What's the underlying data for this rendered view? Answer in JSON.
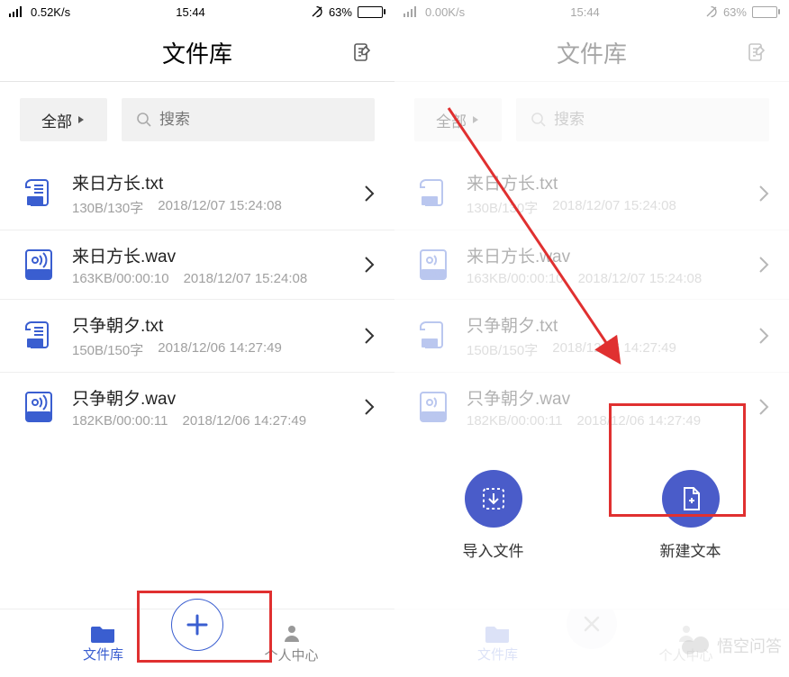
{
  "left": {
    "status": {
      "speed": "0.52K/s",
      "time": "15:44",
      "battery_pct": "63%"
    },
    "title": "文件库",
    "filter_label": "全部",
    "search_placeholder": "搜索",
    "files": [
      {
        "name": "来日方长.txt",
        "size": "130B/130字",
        "date": "2018/12/07 15:24:08",
        "type": "txt"
      },
      {
        "name": "来日方长.wav",
        "size": "163KB/00:00:10",
        "date": "2018/12/07 15:24:08",
        "type": "wav"
      },
      {
        "name": "只争朝夕.txt",
        "size": "150B/150字",
        "date": "2018/12/06 14:27:49",
        "type": "txt"
      },
      {
        "name": "只争朝夕.wav",
        "size": "182KB/00:00:11",
        "date": "2018/12/06 14:27:49",
        "type": "wav"
      }
    ],
    "nav": {
      "library": "文件库",
      "profile": "个人中心"
    }
  },
  "right": {
    "status": {
      "speed": "0.00K/s",
      "time": "15:44",
      "battery_pct": "63%"
    },
    "title": "文件库",
    "filter_label": "全部",
    "search_placeholder": "搜索",
    "files": [
      {
        "name": "来日方长.txt",
        "size": "130B/130字",
        "date": "2018/12/07 15:24:08",
        "type": "txt"
      },
      {
        "name": "来日方长.wav",
        "size": "163KB/00:00:10",
        "date": "2018/12/07 15:24:08",
        "type": "wav"
      },
      {
        "name": "只争朝夕.txt",
        "size": "150B/150字",
        "date": "2018/12/06 14:27:49",
        "type": "txt"
      },
      {
        "name": "只争朝夕.wav",
        "size": "182KB/00:00:11",
        "date": "2018/12/06 14:27:49",
        "type": "wav"
      }
    ],
    "nav": {
      "library": "文件库",
      "profile": "个人中心"
    },
    "actions": {
      "import": "导入文件",
      "new_text": "新建文本"
    },
    "watermark": "悟空问答"
  }
}
